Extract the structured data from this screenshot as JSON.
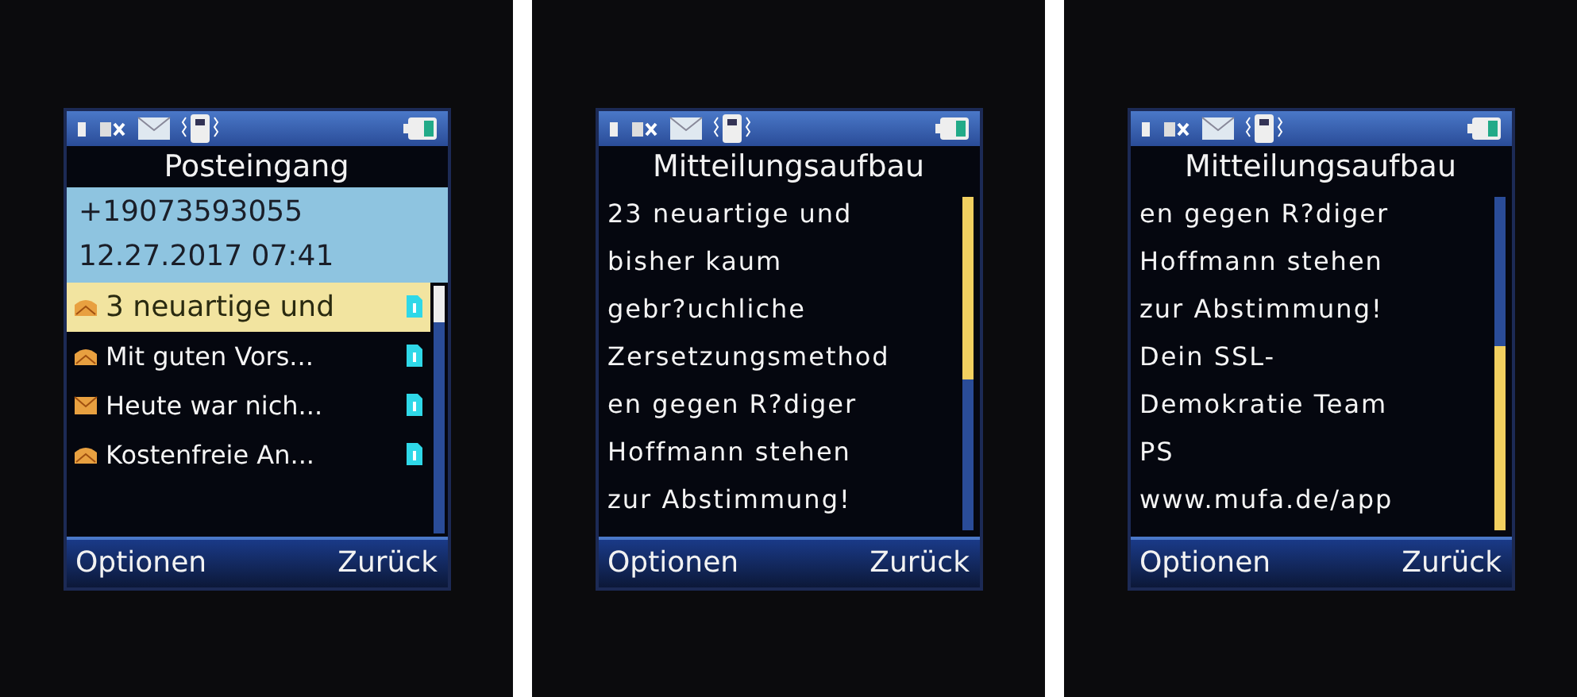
{
  "screens": [
    {
      "kind": "inbox",
      "title": "Posteingang",
      "header": {
        "sender": "+19073593055",
        "date": "12.27.2017 07:41"
      },
      "messages": [
        {
          "text": "3 neuartige und",
          "selected": true,
          "read": true
        },
        {
          "text": "Mit guten Vors...",
          "selected": false,
          "read": true
        },
        {
          "text": "Heute war nich...",
          "selected": false,
          "read": false
        },
        {
          "text": "Kostenfreie An...",
          "selected": false,
          "read": true
        }
      ],
      "softkeys": {
        "left": "Optionen",
        "right": "Zurück"
      }
    },
    {
      "kind": "message",
      "title": "Mitteilungsaufbau",
      "scrolled_to_end": false,
      "lines": [
        "23 neuartige und",
        "bisher kaum",
        "gebr?uchliche",
        "Zersetzungsmethod",
        "en gegen R?diger",
        "Hoffmann stehen",
        "zur Abstimmung!"
      ],
      "softkeys": {
        "left": "Optionen",
        "right": "Zurück"
      }
    },
    {
      "kind": "message",
      "title": "Mitteilungsaufbau",
      "scrolled_to_end": true,
      "lines": [
        "en gegen R?diger",
        "Hoffmann stehen",
        "zur Abstimmung!",
        "Dein SSL-",
        "Demokratie Team",
        "PS",
        "www.mufa.de/app"
      ],
      "softkeys": {
        "left": "Optionen",
        "right": "Zurück"
      }
    }
  ]
}
